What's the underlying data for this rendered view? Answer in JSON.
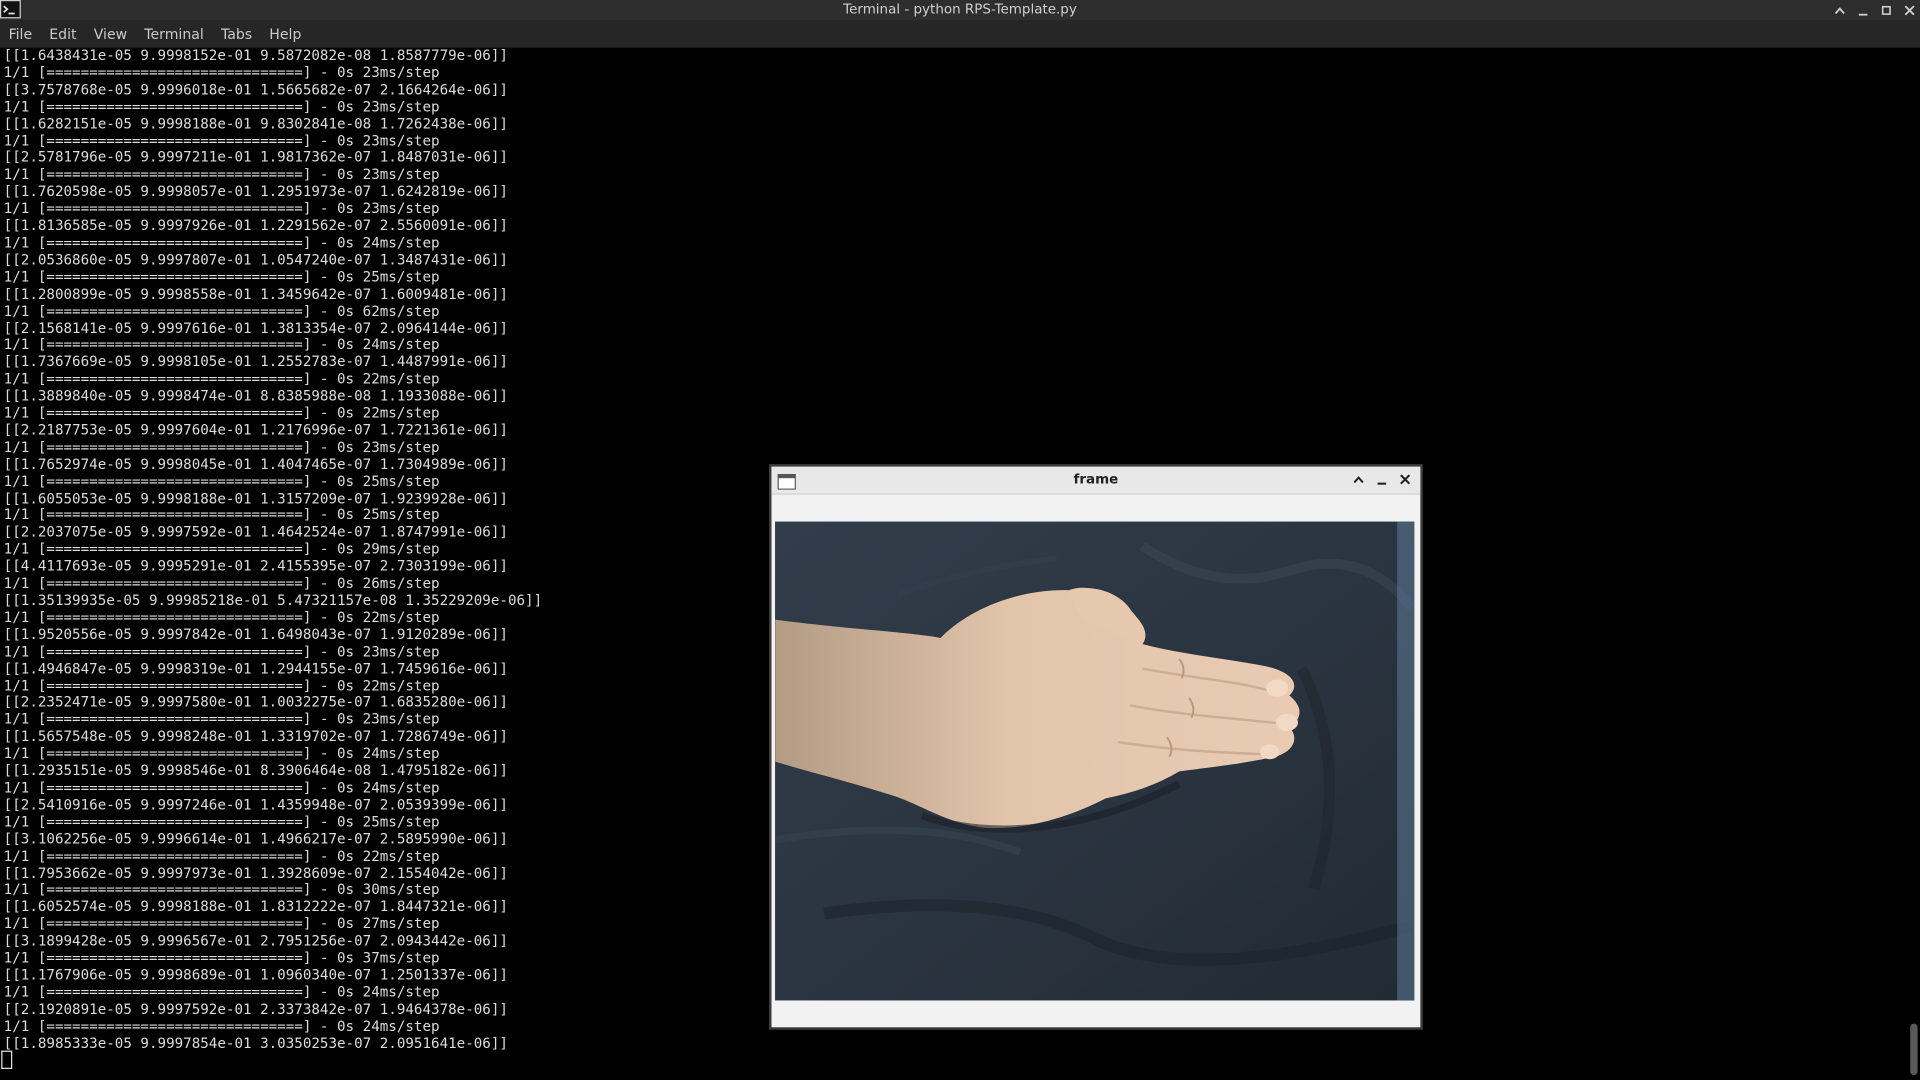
{
  "window": {
    "title": "Terminal - python RPS-Template.py",
    "app_icon": "terminal-icon",
    "controls": [
      "chevron-up-icon",
      "minimize-icon",
      "maximize-icon",
      "close-icon"
    ]
  },
  "menubar": {
    "items": [
      "File",
      "Edit",
      "View",
      "Terminal",
      "Tabs",
      "Help"
    ]
  },
  "terminal": {
    "lines": [
      "[[1.6438431e-05 9.9998152e-01 9.5872082e-08 1.8587779e-06]]",
      "1/1 [==============================] - 0s 23ms/step",
      "[[3.7578768e-05 9.9996018e-01 1.5665682e-07 2.1664264e-06]]",
      "1/1 [==============================] - 0s 23ms/step",
      "[[1.6282151e-05 9.9998188e-01 9.8302841e-08 1.7262438e-06]]",
      "1/1 [==============================] - 0s 23ms/step",
      "[[2.5781796e-05 9.9997211e-01 1.9817362e-07 1.8487031e-06]]",
      "1/1 [==============================] - 0s 23ms/step",
      "[[1.7620598e-05 9.9998057e-01 1.2951973e-07 1.6242819e-06]]",
      "1/1 [==============================] - 0s 23ms/step",
      "[[1.8136585e-05 9.9997926e-01 1.2291562e-07 2.5560091e-06]]",
      "1/1 [==============================] - 0s 24ms/step",
      "[[2.0536860e-05 9.9997807e-01 1.0547240e-07 1.3487431e-06]]",
      "1/1 [==============================] - 0s 25ms/step",
      "[[1.2800899e-05 9.9998558e-01 1.3459642e-07 1.6009481e-06]]",
      "1/1 [==============================] - 0s 62ms/step",
      "[[2.1568141e-05 9.9997616e-01 1.3813354e-07 2.0964144e-06]]",
      "1/1 [==============================] - 0s 24ms/step",
      "[[1.7367669e-05 9.9998105e-01 1.2552783e-07 1.4487991e-06]]",
      "1/1 [==============================] - 0s 22ms/step",
      "[[1.3889840e-05 9.9998474e-01 8.8385988e-08 1.1933088e-06]]",
      "1/1 [==============================] - 0s 22ms/step",
      "[[2.2187753e-05 9.9997604e-01 1.2176996e-07 1.7221361e-06]]",
      "1/1 [==============================] - 0s 23ms/step",
      "[[1.7652974e-05 9.9998045e-01 1.4047465e-07 1.7304989e-06]]",
      "1/1 [==============================] - 0s 25ms/step",
      "[[1.6055053e-05 9.9998188e-01 1.3157209e-07 1.9239928e-06]]",
      "1/1 [==============================] - 0s 25ms/step",
      "[[2.2037075e-05 9.9997592e-01 1.4642524e-07 1.8747991e-06]]",
      "1/1 [==============================] - 0s 29ms/step",
      "[[4.4117693e-05 9.9995291e-01 2.4155395e-07 2.7303199e-06]]",
      "1/1 [==============================] - 0s 26ms/step",
      "[[1.35139935e-05 9.99985218e-01 5.47321157e-08 1.35229209e-06]]",
      "1/1 [==============================] - 0s 22ms/step",
      "[[1.9520556e-05 9.9997842e-01 1.6498043e-07 1.9120289e-06]]",
      "1/1 [==============================] - 0s 23ms/step",
      "[[1.4946847e-05 9.9998319e-01 1.2944155e-07 1.7459616e-06]]",
      "1/1 [==============================] - 0s 22ms/step",
      "[[2.2352471e-05 9.9997580e-01 1.0032275e-07 1.6835280e-06]]",
      "1/1 [==============================] - 0s 23ms/step",
      "[[1.5657548e-05 9.9998248e-01 1.3319702e-07 1.7286749e-06]]",
      "1/1 [==============================] - 0s 24ms/step",
      "[[1.2935151e-05 9.9998546e-01 8.3906464e-08 1.4795182e-06]]",
      "1/1 [==============================] - 0s 24ms/step",
      "[[2.5410916e-05 9.9997246e-01 1.4359948e-07 2.0539399e-06]]",
      "1/1 [==============================] - 0s 25ms/step",
      "[[3.1062256e-05 9.9996614e-01 1.4966217e-07 2.5895990e-06]]",
      "1/1 [==============================] - 0s 22ms/step",
      "[[1.7953662e-05 9.9997973e-01 1.3928609e-07 2.1554042e-06]]",
      "1/1 [==============================] - 0s 30ms/step",
      "[[1.6052574e-05 9.9998188e-01 1.8312222e-07 1.8447321e-06]]",
      "1/1 [==============================] - 0s 27ms/step",
      "[[3.1899428e-05 9.9996567e-01 2.7951256e-07 2.0943442e-06]]",
      "1/1 [==============================] - 0s 37ms/step",
      "[[1.1767906e-05 9.9998689e-01 1.0960340e-07 1.2501337e-06]]",
      "1/1 [==============================] - 0s 24ms/step",
      "[[2.1920891e-05 9.9997592e-01 2.3373842e-07 1.9464378e-06]]",
      "1/1 [==============================] - 0s 24ms/step",
      "[[1.8985333e-05 9.9997854e-01 3.0350253e-07 2.0951641e-06]]"
    ]
  },
  "frame_window": {
    "title": "frame",
    "app_icon": "window-icon",
    "controls": [
      "chevron-up-icon",
      "minimize-icon",
      "close-icon"
    ],
    "content": "webcam-video-hand"
  },
  "colors": {
    "terminal_bg": "#000000",
    "terminal_fg": "#dcdcdc",
    "titlebar_bg": "#2e2e2e",
    "frame_chrome": "#f2f2f2"
  }
}
